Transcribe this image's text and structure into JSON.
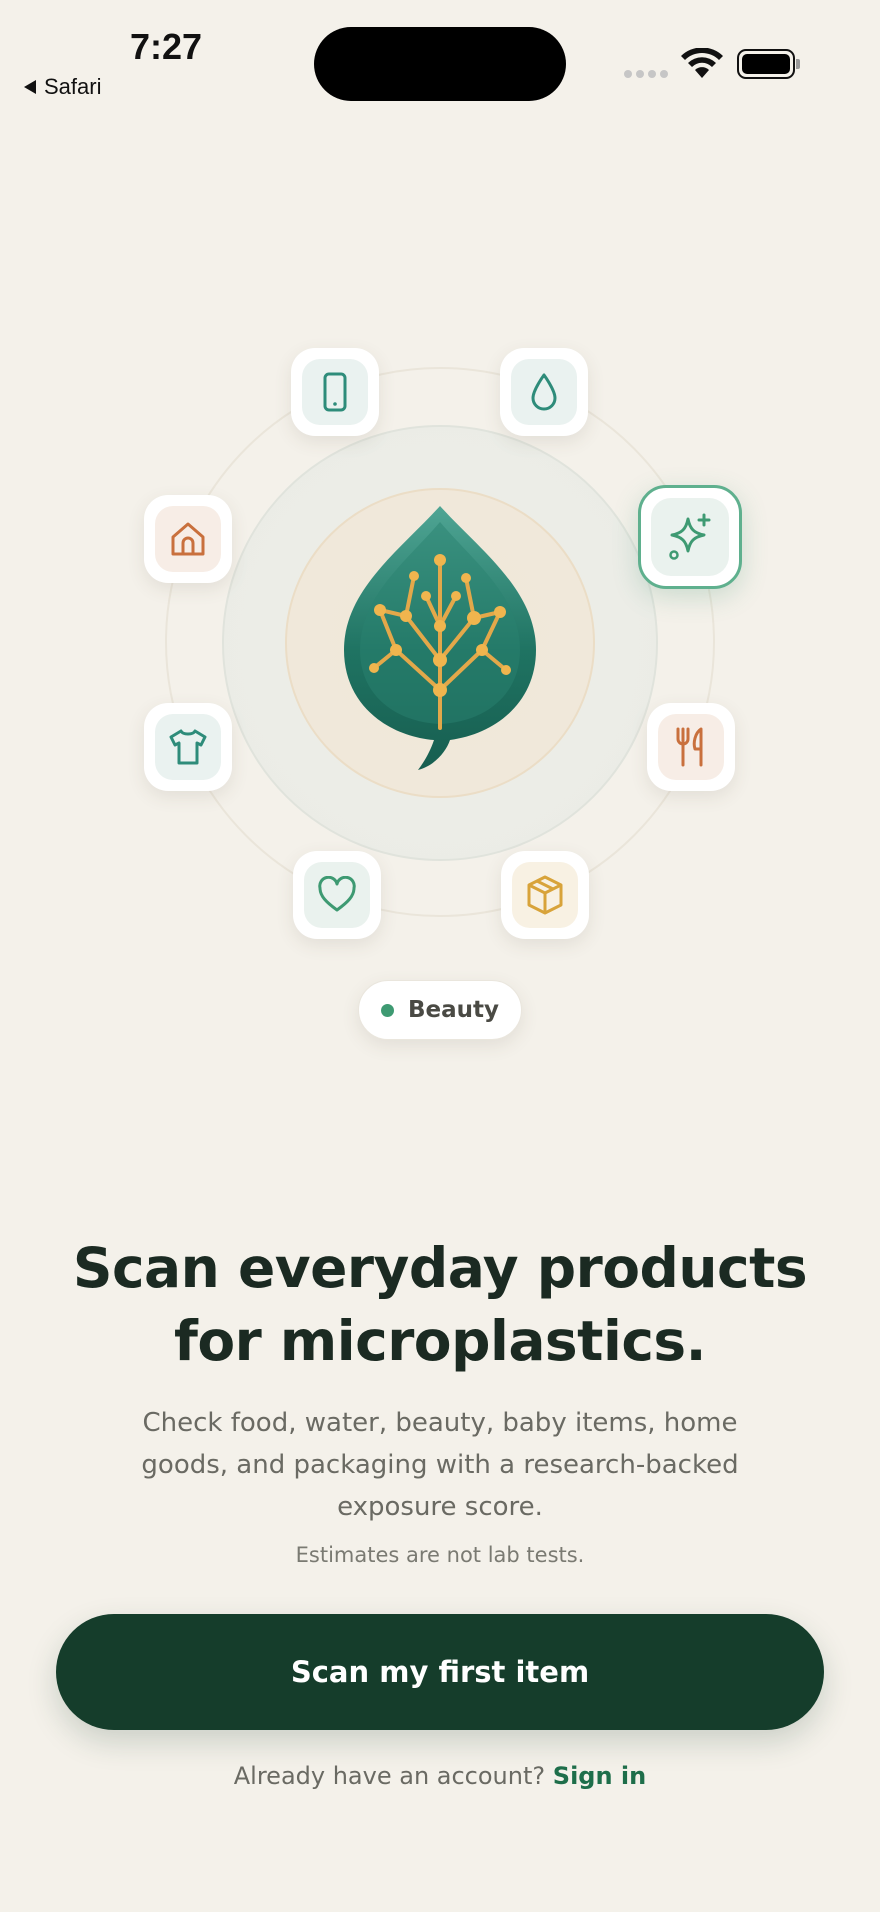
{
  "status_bar": {
    "time": "7:27",
    "back_label": "Safari"
  },
  "illustration": {
    "selected_category": "Beauty",
    "categories": [
      {
        "id": "electronics",
        "icon": "phone-icon"
      },
      {
        "id": "water",
        "icon": "water-drop-icon"
      },
      {
        "id": "home",
        "icon": "house-icon"
      },
      {
        "id": "beauty",
        "icon": "sparkle-icon"
      },
      {
        "id": "clothing",
        "icon": "tshirt-icon"
      },
      {
        "id": "food",
        "icon": "fork-knife-icon"
      },
      {
        "id": "health",
        "icon": "heart-icon"
      },
      {
        "id": "packaging",
        "icon": "package-icon"
      }
    ],
    "colors": {
      "teal": "#2E8C7A",
      "orange": "#C9703D",
      "gold": "#D8A33A",
      "green": "#3E9A72"
    }
  },
  "content": {
    "headline_line1": "Scan everyday products",
    "headline_line2": "for microplastics.",
    "body": "Check food, water, beauty, baby items, home goods, and packaging with a research-backed exposure score.",
    "disclaimer": "Estimates are not lab tests."
  },
  "actions": {
    "primary_button": "Scan my first item",
    "signin_prompt": "Already have an account?",
    "signin_link": "Sign in"
  },
  "theme": {
    "background": "#F4F1EA",
    "primary": "#153D2B",
    "link": "#1E6E4A"
  }
}
